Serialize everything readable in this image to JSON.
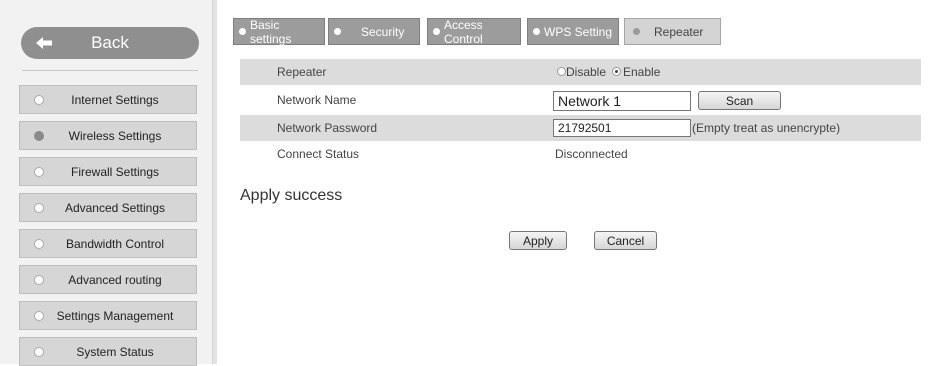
{
  "sidebar": {
    "back_label": "Back",
    "items": [
      {
        "label": "Internet Settings",
        "active": false
      },
      {
        "label": "Wireless Settings",
        "active": true
      },
      {
        "label": "Firewall Settings",
        "active": false
      },
      {
        "label": "Advanced Settings",
        "active": false
      },
      {
        "label": "Bandwidth Control",
        "active": false
      },
      {
        "label": "Advanced routing",
        "active": false
      },
      {
        "label": "Settings Management",
        "active": false
      },
      {
        "label": "System Status",
        "active": false
      }
    ]
  },
  "tabs": [
    {
      "label": "Basic settings",
      "active": false
    },
    {
      "label": "Security",
      "active": false
    },
    {
      "label": "Access Control",
      "active": false
    },
    {
      "label": "WPS Setting",
      "active": false
    },
    {
      "label": "Repeater",
      "active": true
    }
  ],
  "form": {
    "repeater": {
      "label": "Repeater",
      "option_disable": "Disable",
      "option_enable": "Enable",
      "selected": "Enable"
    },
    "network_name": {
      "label": "Network Name",
      "value": "Network 1",
      "scan_label": "Scan"
    },
    "network_password": {
      "label": "Network Password",
      "value": "21792501",
      "hint": "(Empty treat as unencrypte)"
    },
    "connect_status": {
      "label": "Connect Status",
      "value": "Disconnected"
    }
  },
  "message": "Apply success",
  "actions": {
    "apply_label": "Apply",
    "cancel_label": "Cancel"
  },
  "colors": {
    "sidebar_bg": "#f2f2f2",
    "tab_bg": "#9c9c9c",
    "row_shade": "#dcdcdc"
  }
}
